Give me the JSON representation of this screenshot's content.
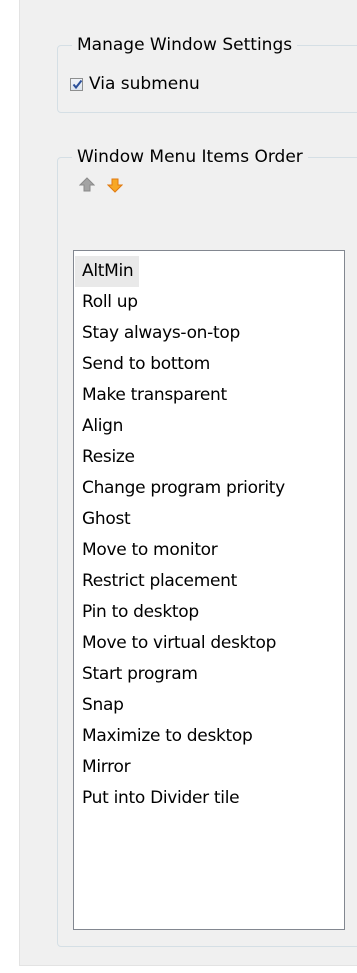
{
  "manage_group": {
    "title": "Manage Window Settings",
    "via_submenu": {
      "label": "Via submenu",
      "checked": true
    }
  },
  "order_group": {
    "title": "Window Menu Items Order",
    "buttons": {
      "up_icon": "arrow-up-gray-icon",
      "down_icon": "arrow-down-orange-icon"
    },
    "items": [
      "AltMin",
      "Roll up",
      "Stay always-on-top",
      "Send to bottom",
      "Make transparent",
      "Align",
      "Resize",
      "Change program priority",
      "Ghost",
      "Move to monitor",
      "Restrict placement",
      "Pin to desktop",
      "Move to virtual desktop",
      "Start program",
      "Snap",
      "Maximize to desktop",
      "Mirror",
      "Put into Divider tile"
    ],
    "selected_index": 0
  },
  "colors": {
    "panel_bg": "#f0f0f0",
    "group_border": "#d5dfe5",
    "list_border": "#828790",
    "selected_bg": "#e9e9e9",
    "down_arrow": "#f5a623",
    "up_arrow": "#9a9a9a"
  }
}
